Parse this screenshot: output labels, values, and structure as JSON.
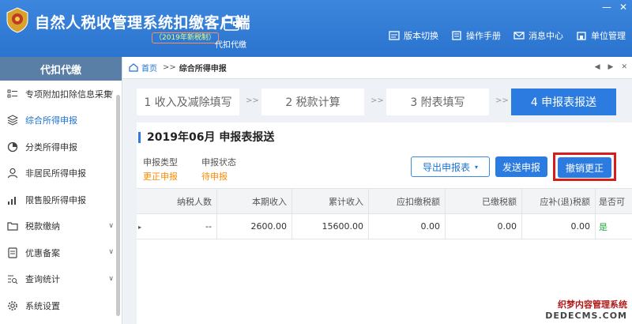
{
  "header": {
    "title": "自然人税收管理系统扣缴客户端",
    "version": "（2019年新税制）",
    "agent_label": "代扣代缴",
    "window_controls": [
      "—",
      "✕"
    ],
    "nav": [
      {
        "label": "版本切换",
        "icon": "version-switch-icon"
      },
      {
        "label": "操作手册",
        "icon": "manual-icon"
      },
      {
        "label": "消息中心",
        "icon": "message-icon"
      },
      {
        "label": "单位管理",
        "icon": "unit-manage-icon"
      }
    ]
  },
  "sidebar": {
    "title": "代扣代缴",
    "items": [
      {
        "label": "专项附加扣除信息采集",
        "icon": "list-icon",
        "arrow": "∨"
      },
      {
        "label": "综合所得申报",
        "icon": "layers-icon"
      },
      {
        "label": "分类所得申报",
        "icon": "pie-icon"
      },
      {
        "label": "非居民所得申报",
        "icon": "user-icon"
      },
      {
        "label": "限售股所得申报",
        "icon": "bar-chart-icon"
      },
      {
        "label": "税款缴纳",
        "icon": "folder-icon",
        "arrow": "∨"
      },
      {
        "label": "优惠备案",
        "icon": "document-icon",
        "arrow": "∨"
      },
      {
        "label": "查询统计",
        "icon": "query-icon",
        "arrow": "∨"
      },
      {
        "label": "系统设置",
        "icon": "gear-icon"
      }
    ]
  },
  "breadcrumb": {
    "home": "首页",
    "sep": ">>",
    "current": "综合所得申报",
    "controls": [
      "◀",
      "▶",
      "✕"
    ]
  },
  "steps": [
    {
      "label": "1 收入及减除填写"
    },
    {
      "label": "2 税款计算"
    },
    {
      "label": "3 附表填写"
    },
    {
      "label": "4 申报表报送"
    }
  ],
  "step_separator": ">>",
  "panel": {
    "title": "2019年06月  申报表报送",
    "info": [
      {
        "label": "申报类型",
        "value": "更正申报"
      },
      {
        "label": "申报状态",
        "value": "待申报"
      }
    ],
    "buttons": {
      "export": "导出申报表",
      "export_caret": "▾",
      "send": "发送申报",
      "revoke": "撤销更正"
    }
  },
  "table": {
    "headers": [
      "纳税人数",
      "本期收入",
      "累计收入",
      "应扣缴税额",
      "已缴税额",
      "应补(退)税额",
      "是否可"
    ],
    "row_mark": "▸",
    "row": [
      "--",
      "2600.00",
      "15600.00",
      "0.00",
      "0.00",
      "0.00",
      "是"
    ]
  },
  "watermark": {
    "cn": "织梦内容管理系统",
    "en": "DEDECMS.COM"
  },
  "colors": {
    "header_blue": "#2b74cf",
    "sidebar_head": "#5a7fa6",
    "accent_blue": "#2b7be0",
    "orange_value": "#ff8a00",
    "highlight_red": "#d81c1c"
  }
}
